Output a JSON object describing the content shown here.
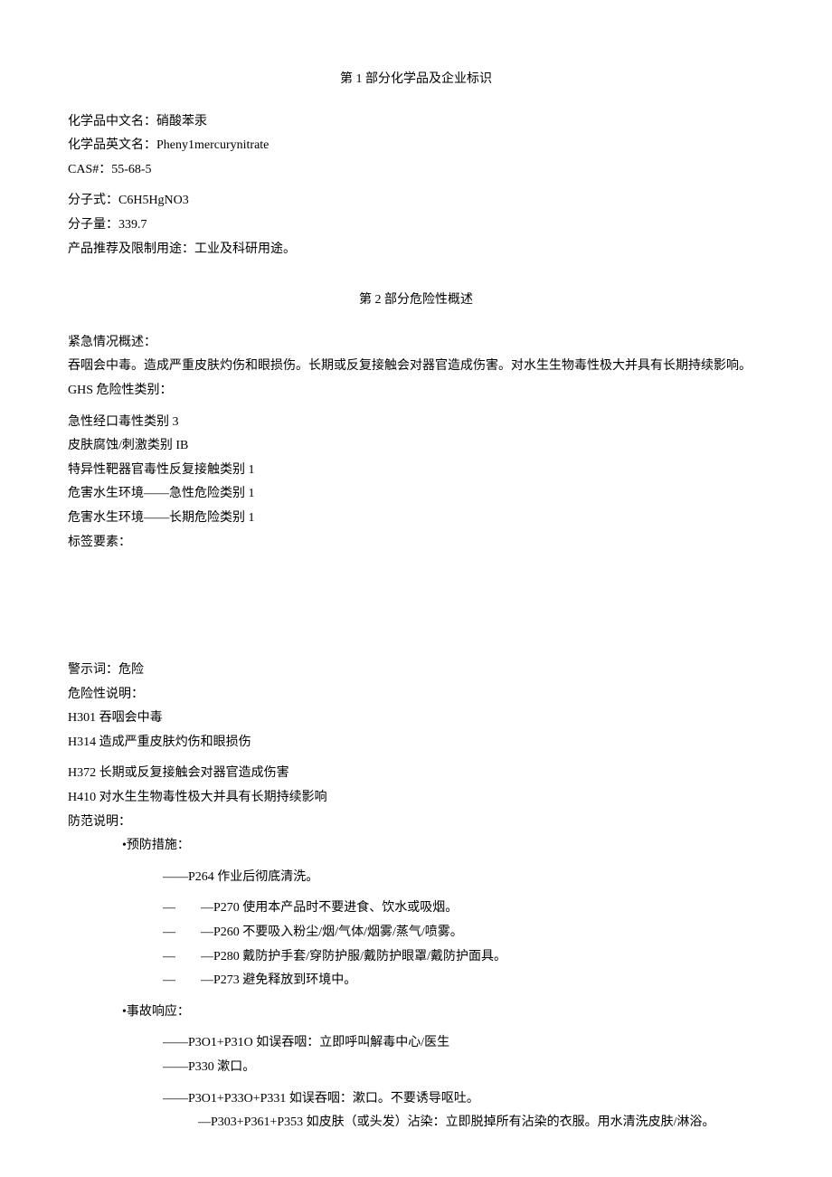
{
  "section1": {
    "title": "第 1 部分化学品及企业标识",
    "name_cn_label": "化学品中文名：",
    "name_cn_value": "硝酸苯汞",
    "name_en_label": "化学品英文名：",
    "name_en_value": "Pheny1mercurynitrate",
    "cas_label": "CAS#：",
    "cas_value": "55-68-5",
    "formula_label": "分子式：",
    "formula_value": "C6H5HgNO3",
    "mw_label": "分子量：",
    "mw_value": "339.7",
    "use_label": "产品推荐及限制用途：",
    "use_value": "工业及科研用途。"
  },
  "section2": {
    "title": "第 2 部分危险性概述",
    "emergency_label": "紧急情况概述：",
    "emergency_text": "吞咽会中毒。造成严重皮肤灼伤和眼损伤。长期或反复接触会对器官造成伤害。对水生生物毒性极大并具有长期持续影响。",
    "ghs_label": "GHS 危险性类别：",
    "ghs_items": [
      "急性经口毒性类别 3",
      "皮肤腐蚀/刺激类别 IB",
      "特异性靶器官毒性反复接触类别 1",
      "危害水生环境——急性危险类别 1",
      "危害水生环境——长期危险类别 1"
    ],
    "label_elements": "标签要素：",
    "signal_word_label": "警示词：",
    "signal_word_value": "危险",
    "hazard_stmt_label": "危险性说明：",
    "hazard_stmts": [
      "H301 吞咽会中毒",
      "H314 造成严重皮肤灼伤和眼损伤",
      "H372 长期或反复接触会对器官造成伤害",
      "H410 对水生生物毒性极大并具有长期持续影响"
    ],
    "precaution_label": "防范说明：",
    "prevention_label": "•预防措施：",
    "prevention_items": [
      "——P264 作业后彻底清洗。",
      "—  —P270 使用本产品时不要进食、饮水或吸烟。",
      "—  —P260 不要吸入粉尘/烟/气体/烟雾/蒸气/喷雾。",
      "—  —P280 戴防护手套/穿防护服/戴防护眼罩/戴防护面具。",
      "—  —P273 避免释放到环境中。"
    ],
    "response_label": "•事故响应：",
    "response_items": [
      "——P3O1+P31O 如误吞咽：立即呼叫解毒中心/医生",
      "——P330 漱口。",
      "——P3O1+P33O+P331 如误吞咽：漱口。不要诱导呕吐。"
    ],
    "response_wrap1": " —P303+P361+P353 如皮肤（或头发）沾染：立即脱掉所有沾染的衣服。用水清洗皮肤/淋浴。"
  }
}
